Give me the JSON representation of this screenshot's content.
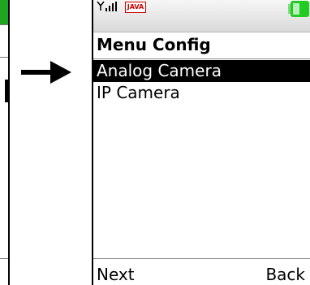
{
  "status_bar": {
    "signal_icon": "signal-strength-icon",
    "java_label": "JAVA",
    "battery_icon": "battery-icon",
    "battery_color": "#22cc22"
  },
  "screen": {
    "title": "Menu Config",
    "items": [
      {
        "label": "Analog Camera",
        "selected": true
      },
      {
        "label": "IP Camera",
        "selected": false
      }
    ]
  },
  "softkeys": {
    "left_label": "Next",
    "right_label": "Back"
  },
  "transition_arrow": "right-arrow-icon",
  "left_screen_accent": "#1fa51f"
}
